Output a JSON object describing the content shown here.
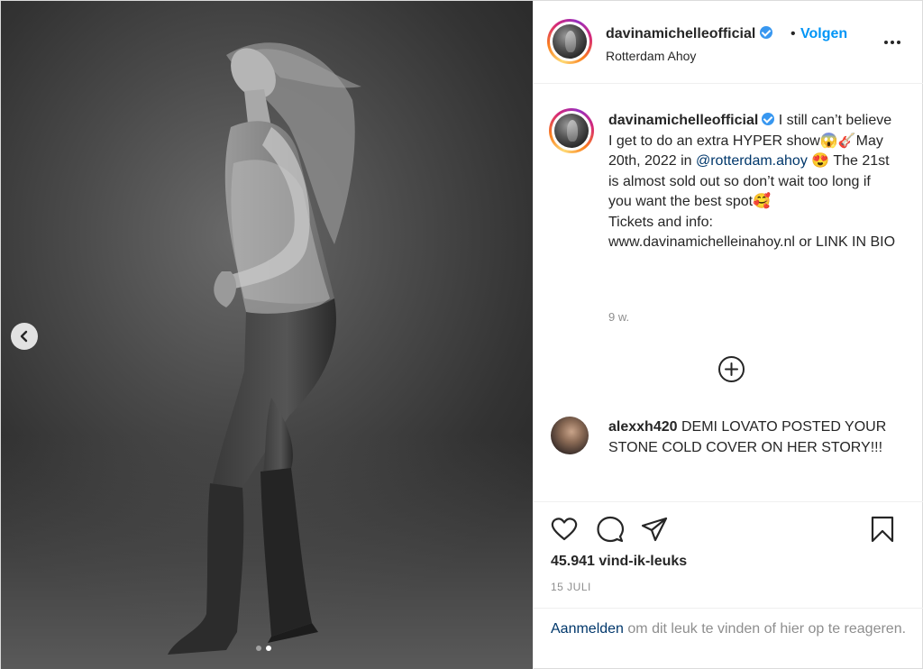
{
  "post": {
    "username": "davinamichelleofficial",
    "follow_sep": "•",
    "follow_label": "Volgen",
    "location": "Rotterdam Ahoy",
    "media": {
      "slide_count": 2,
      "active_slide": 2
    }
  },
  "caption": {
    "username": "davinamichelleofficial",
    "text_1": " I still can’t believe I get to do an extra HYPER show😱🎸May 20th, 2022 in ",
    "mention": "@rotterdam.ahoy",
    "text_2": " 😍 The 21st is almost sold out so don’t wait too long if you want the best spot🥰",
    "text_3": "Tickets and info: www.davinamichelleinahoy.nl or LINK IN BIO",
    "time": "9 w."
  },
  "comment": {
    "username": "alexxh420",
    "text": " DEMI LOVATO POSTED YOUR STONE COLD COVER ON HER STORY!!!"
  },
  "footer": {
    "likes": "45.941 vind-ik-leuks",
    "date": "15 JULI",
    "login_link": "Aanmelden",
    "login_text": " om dit leuk te vinden of hier op te reageren."
  },
  "icons": {
    "like": "heart-icon",
    "comment": "comment-icon",
    "share": "share-icon",
    "save": "bookmark-icon",
    "load_more": "plus-circle-icon",
    "prev": "chevron-left-icon",
    "more": "more-options-icon",
    "verified": "verified-badge-icon"
  },
  "colors": {
    "accent": "#0095f6",
    "mention": "#00376b",
    "verified": "#3897f0",
    "muted": "#8e8e8e"
  }
}
